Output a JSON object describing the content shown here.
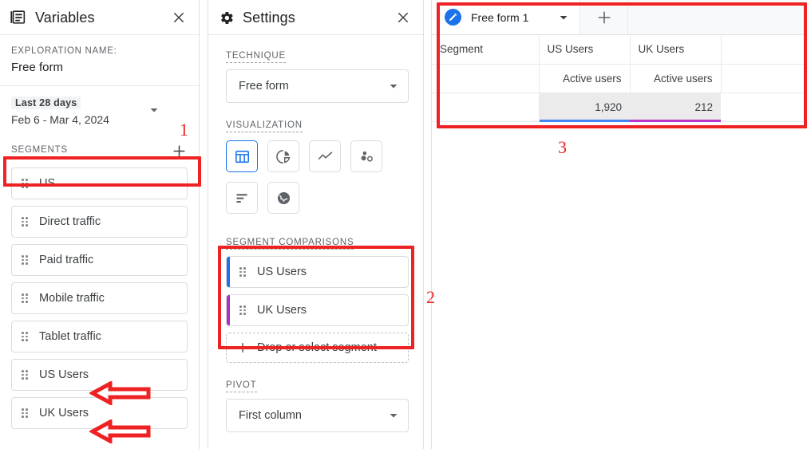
{
  "variables": {
    "header_title": "Variables",
    "header_icon": "variables-document-icon",
    "close_icon": "close-icon",
    "exploration_label": "EXPLORATION NAME:",
    "exploration_name": "Free form",
    "date_chip": "Last 28 days",
    "date_range": "Feb 6 - Mar 4, 2024",
    "segments_label": "SEGMENTS",
    "segments_add_icon": "plus-icon",
    "segments": [
      {
        "label": "US"
      },
      {
        "label": "Direct traffic"
      },
      {
        "label": "Paid traffic"
      },
      {
        "label": "Mobile traffic"
      },
      {
        "label": "Tablet traffic"
      },
      {
        "label": "US Users"
      },
      {
        "label": "UK Users"
      }
    ]
  },
  "settings": {
    "header_title": "Settings",
    "header_icon": "gear-icon",
    "close_icon": "close-icon",
    "technique_label": "TECHNIQUE",
    "technique_value": "Free form",
    "visualization_label": "VISUALIZATION",
    "visualizations": [
      {
        "name": "table-chart-icon",
        "selected": true
      },
      {
        "name": "donut-chart-icon",
        "selected": false
      },
      {
        "name": "line-chart-icon",
        "selected": false
      },
      {
        "name": "scatter-chart-icon",
        "selected": false
      },
      {
        "name": "bar-chart-icon",
        "selected": false
      },
      {
        "name": "geo-map-icon",
        "selected": false
      }
    ],
    "segment_comparisons_label": "SEGMENT COMPARISONS",
    "segment_comparisons": [
      {
        "label": "US Users",
        "color": "#1a73e8"
      },
      {
        "label": "UK Users",
        "color": "#ab30c4"
      }
    ],
    "drop_zone_label": "Drop or select segment",
    "drop_zone_icon": "plus-icon",
    "pivot_label": "PIVOT",
    "pivot_value": "First column"
  },
  "report": {
    "tab_title": "Free form 1",
    "tab_icon": "edit-pencil-icon",
    "tab_caret_icon": "chevron-down-icon",
    "add_tab_icon": "plus-icon",
    "table": {
      "header_row": [
        "Segment",
        "US Users",
        "UK Users"
      ],
      "metric_row": [
        "",
        "Active users",
        "Active users"
      ],
      "value_row": [
        "",
        "1,920",
        "212"
      ],
      "bar_colors": [
        "",
        "#4285f4",
        "#ba35c9"
      ]
    }
  },
  "annotations": {
    "numbers": [
      "1",
      "2",
      "3"
    ],
    "arrow_icon": "left-arrow-annotation"
  }
}
